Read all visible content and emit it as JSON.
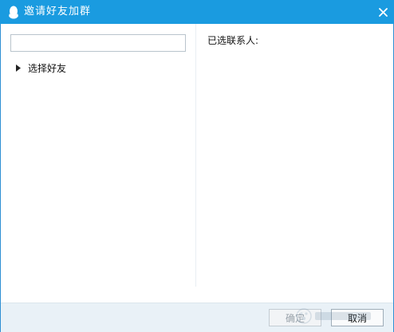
{
  "window": {
    "title": "邀请好友加群",
    "title_icon": "qq-penguin-icon",
    "close_icon": "close-icon"
  },
  "left_pane": {
    "search": {
      "value": "",
      "placeholder": ""
    },
    "tree": [
      {
        "label": "选择好友",
        "icon": "triangle-right-icon",
        "expanded": false
      }
    ]
  },
  "right_pane": {
    "selected_label": "已选联系人:"
  },
  "footer": {
    "ok_label": "确定",
    "cancel_label": "取消"
  },
  "colors": {
    "titlebar": "#1a9be0",
    "footer": "#e9f1f7",
    "border": "#2f8fd3"
  }
}
